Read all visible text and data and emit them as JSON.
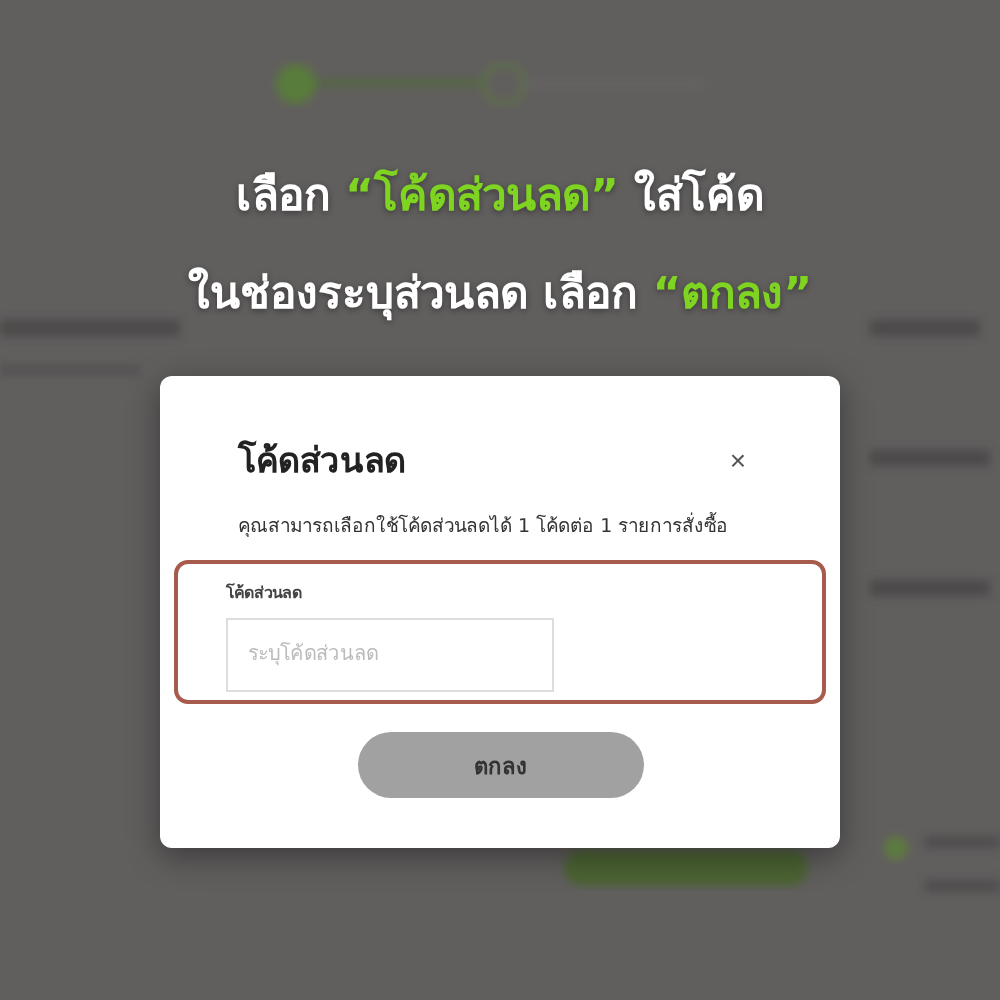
{
  "headline": [
    "เลือก **“โค้ดส่วนลด”** ใส่โค้ด",
    "ในช่องระบุส่วนลด เลือก **“ตกลง”**"
  ],
  "dialog": {
    "title": "โค้ดส่วนลด",
    "close": "×",
    "description": "คุณสามารถเลือกใช้โค้ดส่วนลดได้ 1 โค้ดต่อ 1 รายการสั่งซื้อ",
    "field": {
      "label": "โค้ดส่วนลด",
      "placeholder": "ระบุโค้ดส่วนลด",
      "highlighted": true
    },
    "button": "ตกลง"
  }
}
